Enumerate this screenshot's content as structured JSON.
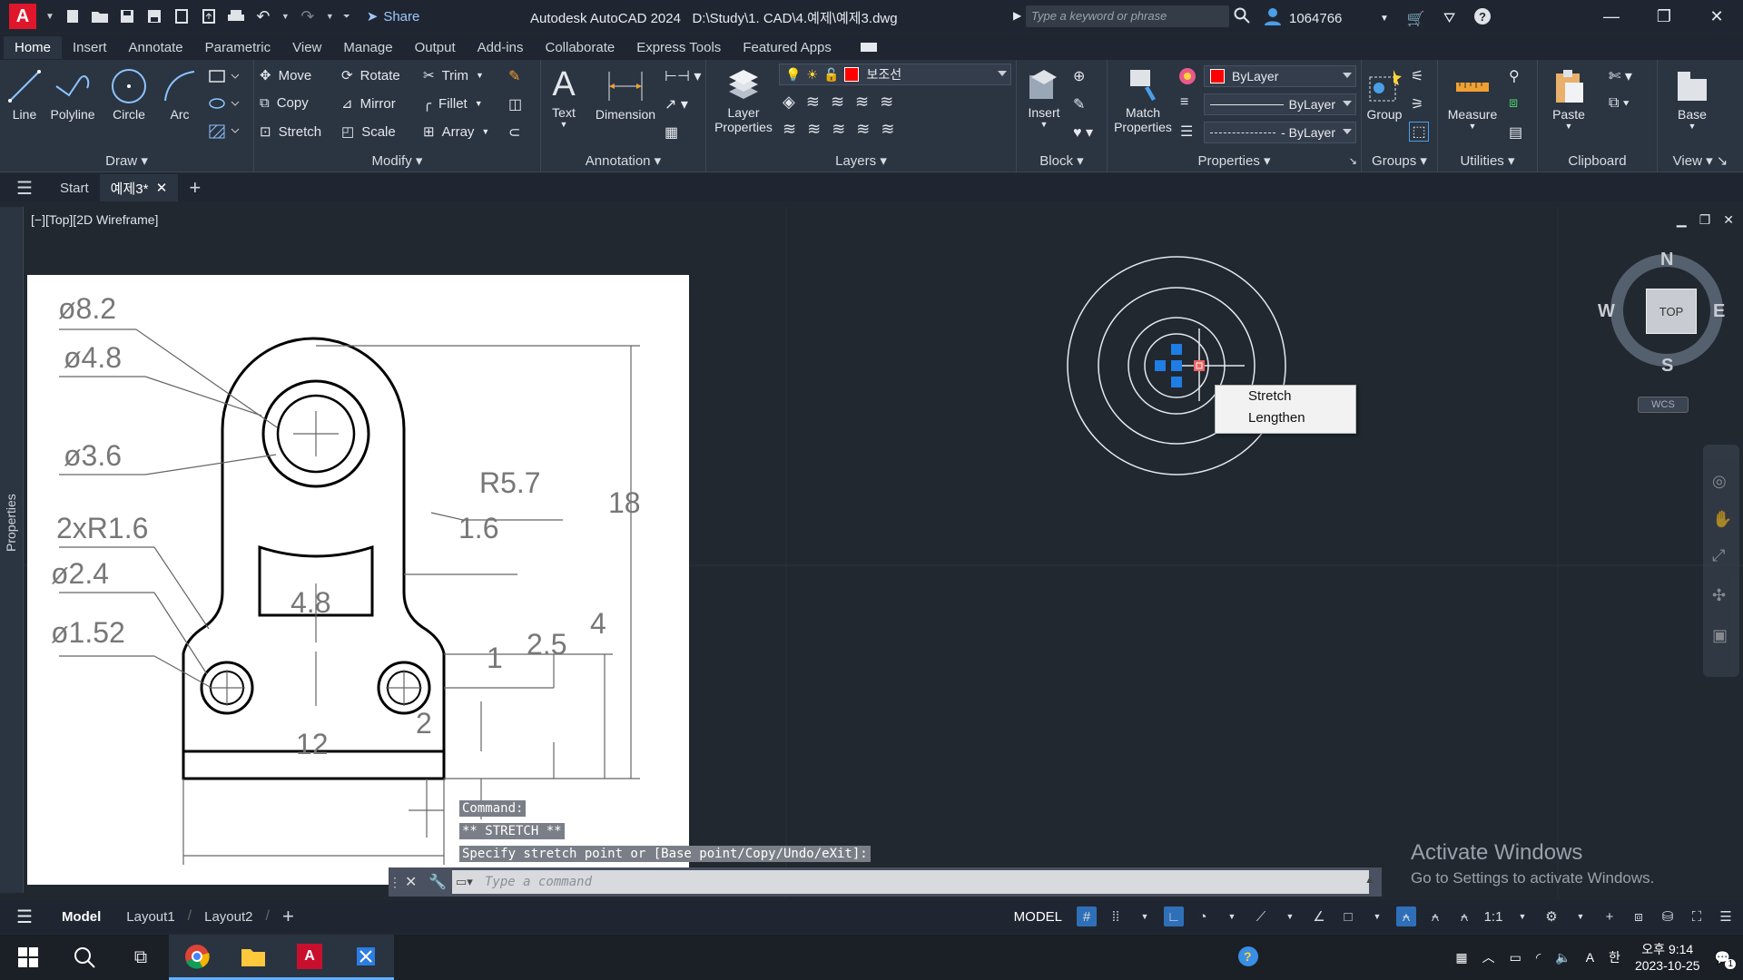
{
  "app": {
    "title": "Autodesk AutoCAD 2024",
    "file_path": "D:\\Study\\1. CAD\\4.예제\\예제3.dwg",
    "share_label": "Share",
    "search_placeholder": "Type a keyword or phrase",
    "user_id": "1064766",
    "logo_letter": "A"
  },
  "ribbon_tabs": [
    "Home",
    "Insert",
    "Annotate",
    "Parametric",
    "View",
    "Manage",
    "Output",
    "Add-ins",
    "Collaborate",
    "Express Tools",
    "Featured Apps"
  ],
  "ribbon": {
    "draw": {
      "title": "Draw",
      "line": "Line",
      "polyline": "Polyline",
      "circle": "Circle",
      "arc": "Arc"
    },
    "modify": {
      "title": "Modify",
      "move": "Move",
      "rotate": "Rotate",
      "trim": "Trim",
      "copy": "Copy",
      "mirror": "Mirror",
      "fillet": "Fillet",
      "stretch": "Stretch",
      "scale": "Scale",
      "array": "Array"
    },
    "annotation": {
      "title": "Annotation",
      "text": "Text",
      "dimension": "Dimension"
    },
    "layers": {
      "title": "Layers",
      "layer_properties_1": "Layer",
      "layer_properties_2": "Properties",
      "current_layer": "보조선"
    },
    "block": {
      "title": "Block",
      "insert": "Insert"
    },
    "properties": {
      "title": "Properties",
      "match_1": "Match",
      "match_2": "Properties",
      "color": "ByLayer",
      "lineweight": "ByLayer",
      "linetype": "- ByLayer"
    },
    "groups": {
      "title": "Groups",
      "group": "Group"
    },
    "utilities": {
      "title": "Utilities",
      "measure": "Measure"
    },
    "clipboard": {
      "title": "Clipboard",
      "paste": "Paste"
    },
    "view": {
      "title": "View",
      "base": "Base"
    }
  },
  "doc_tabs": {
    "start": "Start",
    "active": "예제3*"
  },
  "viewport": {
    "label": "[−][Top][2D Wireframe]"
  },
  "viewcube": {
    "n": "N",
    "s": "S",
    "e": "E",
    "w": "W",
    "face": "TOP",
    "wcs": "WCS"
  },
  "sidebar": {
    "properties": "Properties"
  },
  "context_menu": [
    "Stretch",
    "Lengthen"
  ],
  "command_history": [
    "Command:",
    "** STRETCH **",
    "Specify stretch point or [Base point/Copy/Undo/eXit]:"
  ],
  "command_placeholder": "Type a command",
  "reference_drawing": {
    "labels": [
      "ø8.2",
      "ø4.8",
      "ø3.6",
      "R5.7",
      "18",
      "1.6",
      "2xR1.6",
      "ø2.4",
      "4.8",
      "4",
      "2.5",
      "ø1.52",
      "1",
      "2",
      "12"
    ]
  },
  "activate_windows": {
    "title": "Activate Windows",
    "subtitle": "Go to Settings to activate Windows."
  },
  "status_bar": {
    "tabs": [
      "Model",
      "Layout1",
      "Layout2"
    ],
    "model_label": "MODEL",
    "scale": "1:1"
  },
  "taskbar": {
    "time": "오후 9:14",
    "date": "2023-10-25",
    "ime": "한",
    "lang": "A",
    "notif_count": "1"
  }
}
